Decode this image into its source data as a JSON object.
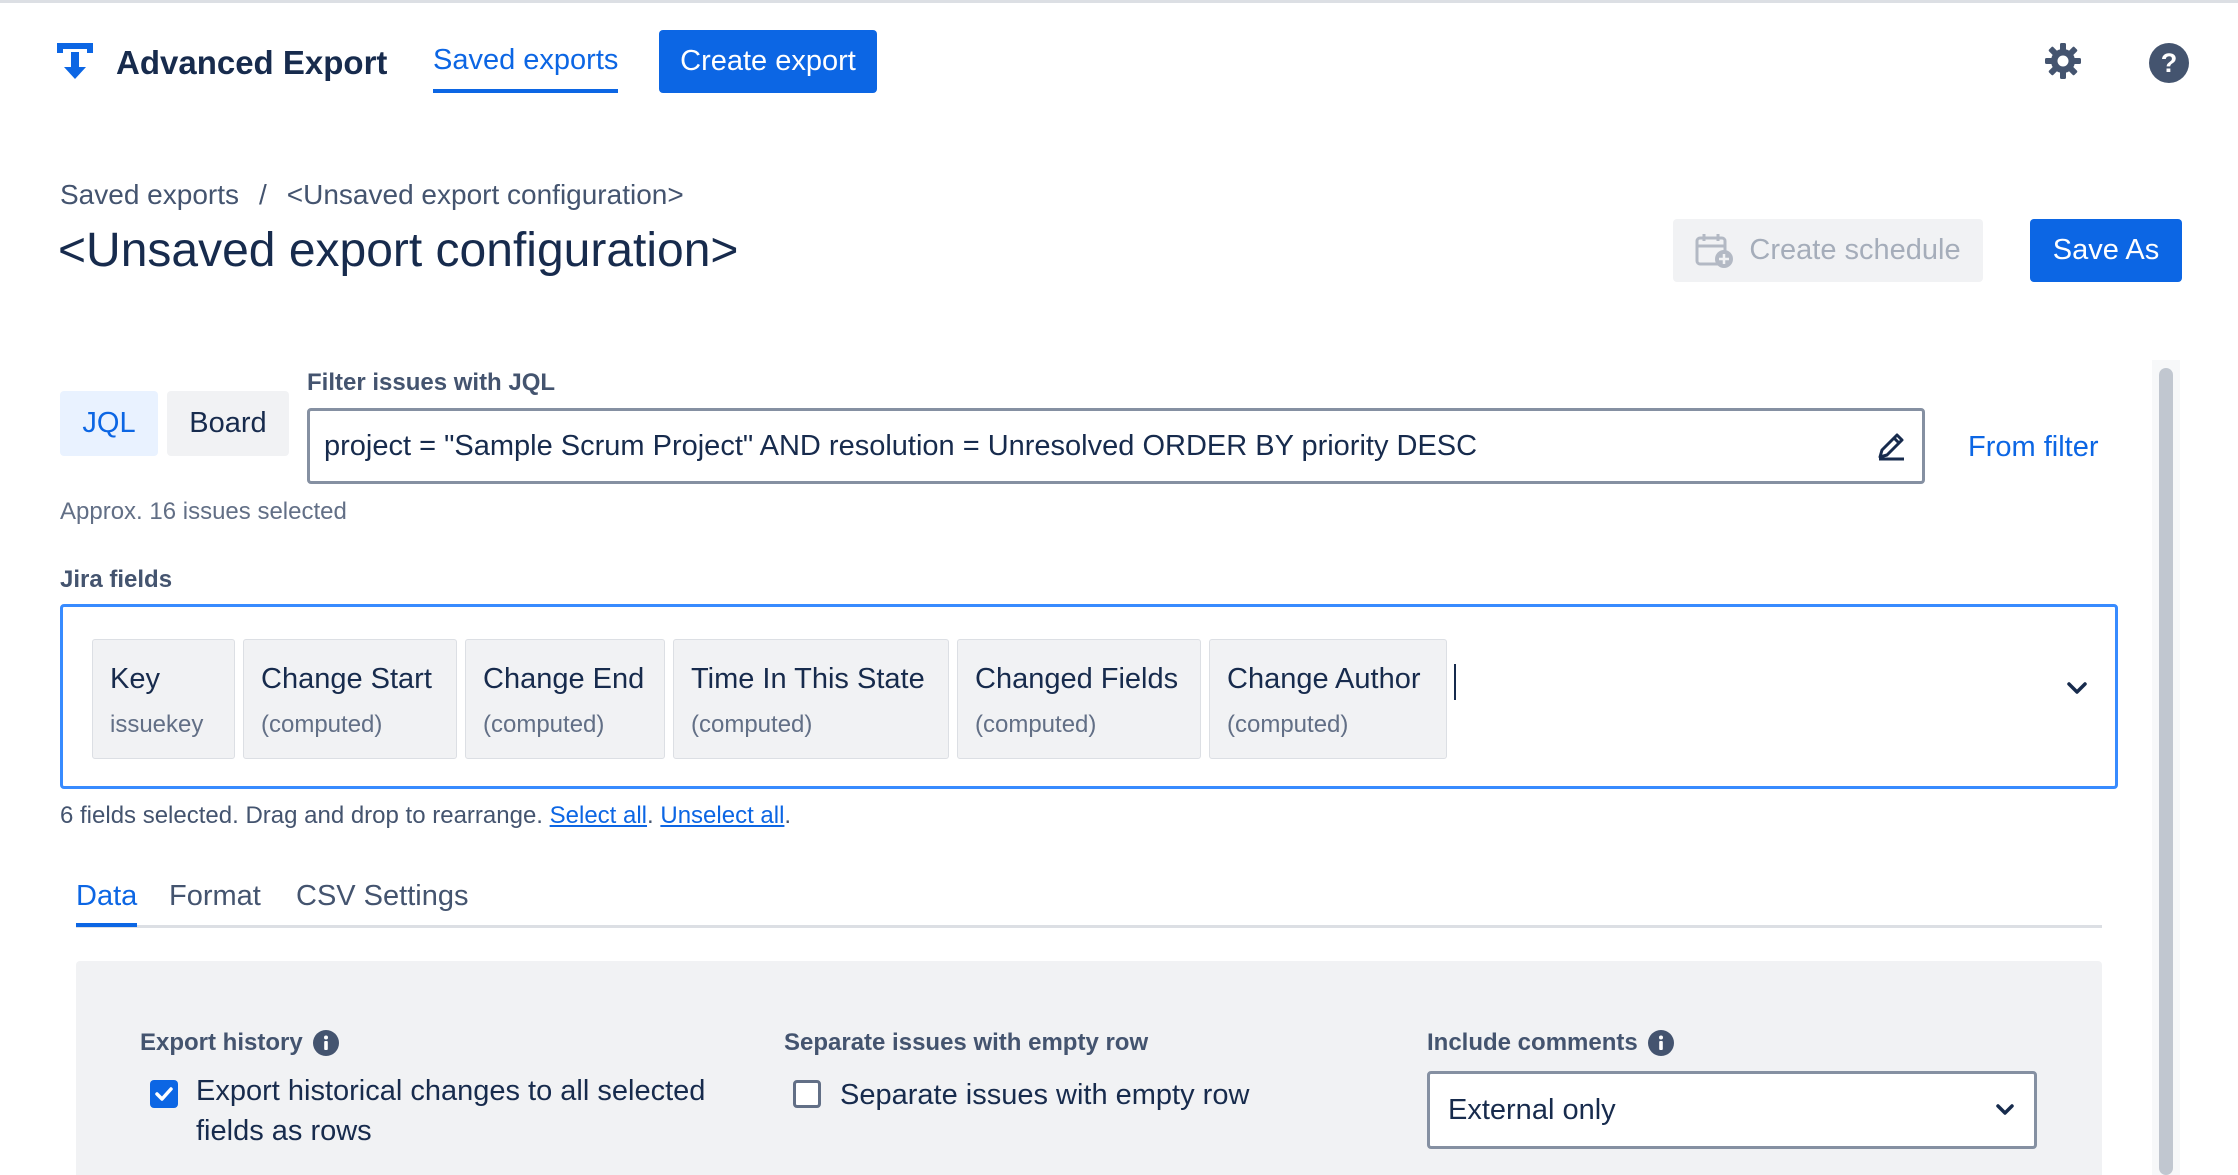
{
  "app": {
    "title": "Advanced Export"
  },
  "nav": {
    "saved_exports": "Saved exports",
    "create_export": "Create export"
  },
  "breadcrumb": {
    "root": "Saved exports",
    "separator": "/",
    "current": "<Unsaved export configuration>"
  },
  "page": {
    "title": "<Unsaved export configuration>",
    "create_schedule": "Create schedule",
    "save_as": "Save As"
  },
  "filter": {
    "tab_jql": "JQL",
    "tab_board": "Board",
    "label": "Filter issues with JQL",
    "query": "project = \"Sample Scrum Project\" AND resolution = Unresolved ORDER BY priority DESC",
    "from_filter": "From filter",
    "approx": "Approx. 16 issues selected"
  },
  "fields": {
    "label": "Jira fields",
    "chips": [
      {
        "name": "Key",
        "sub": "issuekey"
      },
      {
        "name": "Change Start",
        "sub": "(computed)"
      },
      {
        "name": "Change End",
        "sub": "(computed)"
      },
      {
        "name": "Time In This State",
        "sub": "(computed)"
      },
      {
        "name": "Changed Fields",
        "sub": "(computed)"
      },
      {
        "name": "Change Author",
        "sub": "(computed)"
      }
    ],
    "status_text": "6 fields selected. Drag and drop to rearrange. ",
    "select_all": "Select all",
    "unselect_all": "Unselect all"
  },
  "tabs": {
    "data": "Data",
    "format": "Format",
    "csv": "CSV Settings",
    "active": "Data"
  },
  "settings": {
    "export_history": {
      "label": "Export history",
      "option": "Export historical changes to all selected fields as rows",
      "checked": true
    },
    "separate": {
      "label": "Separate issues with empty row",
      "option": "Separate issues with empty row",
      "checked": false
    },
    "comments": {
      "label": "Include comments",
      "value": "External only"
    }
  },
  "icons": {
    "logo": "export-logo-icon",
    "settings": "gear-icon",
    "help": "help-icon",
    "schedule": "calendar-plus-icon",
    "edit": "pencil-icon",
    "info": "info-icon",
    "dropdown": "chevron-down-icon"
  },
  "colors": {
    "primary": "#0c66e4",
    "text": "#172b4d",
    "subtle": "#44546f",
    "focus": "#388bff"
  }
}
